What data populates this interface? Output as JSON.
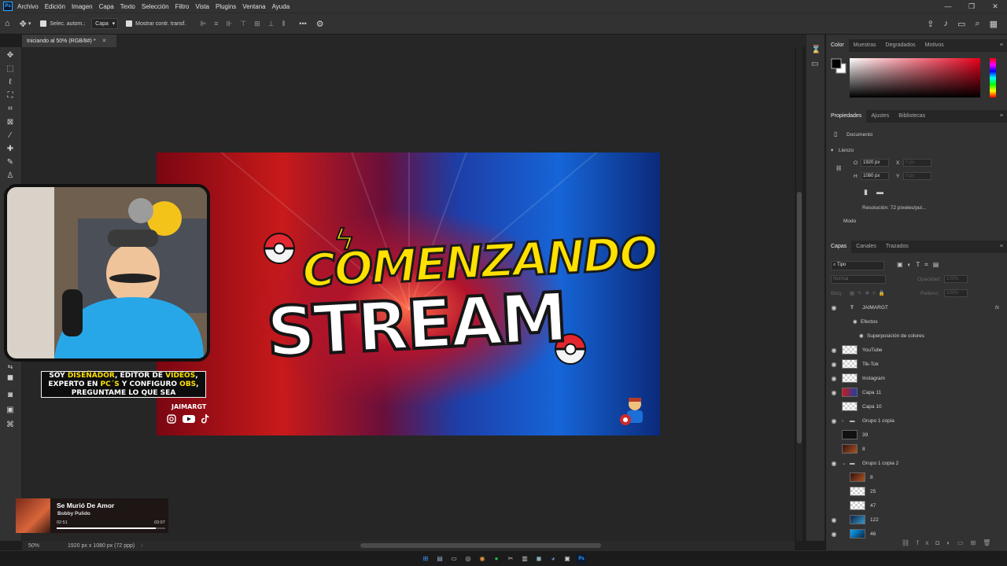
{
  "app": {
    "logo_text": "Ps"
  },
  "menubar": {
    "items": [
      "Archivo",
      "Edición",
      "Imagen",
      "Capa",
      "Texto",
      "Selección",
      "Filtro",
      "Vista",
      "Plugins",
      "Ventana",
      "Ayuda"
    ],
    "window_buttons": [
      "—",
      "❐",
      "✕"
    ]
  },
  "options": {
    "auto_select_label": "Selec. autom.:",
    "auto_select_value": "Capa",
    "show_transform_label": "Mostrar contr. transf.",
    "more_label": "•••"
  },
  "document": {
    "tab_title": "Iniciando al 50% (RGB/8#) *",
    "zoom": "50%",
    "dimensions": "1920 px x 1080 px (72 ppp)"
  },
  "artwork": {
    "title_top": "COMENZANDO",
    "title_main": "STREAM",
    "promo_parts": [
      "SOY ",
      "DISEÑADOR",
      ", EDITOR DE ",
      "VIDEOS",
      ", EXPERTO EN ",
      "PC´S",
      " Y CONFIGURO ",
      "OBS",
      ", PREGUNTAME LO QUE SEA"
    ],
    "handle": "JAIMARGT",
    "accent_color": "#ffe100"
  },
  "music": {
    "song": "Se Murió De Amor",
    "artist": "Bobby Pulido",
    "elapsed": "02:51",
    "duration": "03:07",
    "progress": 0.91
  },
  "panels": {
    "color_tabs": [
      "Color",
      "Muestras",
      "Degradados",
      "Motivos"
    ],
    "props_tabs": [
      "Propiedades",
      "Ajustes",
      "Bibliotecas"
    ],
    "props": {
      "section": "Documento",
      "canvas_heading": "Lienzo",
      "w_label": "O",
      "w_value": "1920 px",
      "h_label": "H",
      "h_value": "1080 px",
      "x_label": "X",
      "x_value": "0 px",
      "y_label": "Y",
      "y_value": "0 px",
      "resolution": "Resolución: 72 píxeles/pul...",
      "mode_label": "Modo"
    },
    "layers_tabs": [
      "Capas",
      "Canales",
      "Trazados"
    ],
    "layers_filter": "Tipo",
    "blend_mode": "Normal",
    "opacity_label": "Opacidad:",
    "opacity_value": "100%",
    "lock_label": "Bloq.:",
    "fill_label": "Relleno:",
    "fill_value": "100%",
    "layers": [
      {
        "name": "JAIMARGT",
        "visible": true,
        "type": "text",
        "fx": true
      },
      {
        "name": "Efectos",
        "visible": true,
        "type": "effects"
      },
      {
        "name": "Superposición de colores",
        "visible": true,
        "type": "effect"
      },
      {
        "name": "YouTube",
        "visible": true,
        "type": "layer"
      },
      {
        "name": "Tik-Tok",
        "visible": true,
        "type": "layer"
      },
      {
        "name": "Instagram",
        "visible": true,
        "type": "layer"
      },
      {
        "name": "Capa 11",
        "visible": true,
        "type": "layer"
      },
      {
        "name": "Capa 10",
        "visible": false,
        "type": "layer"
      },
      {
        "name": "Grupo 1 copia",
        "visible": true,
        "type": "group"
      },
      {
        "name": "39",
        "visible": false,
        "type": "layer"
      },
      {
        "name": "8",
        "visible": false,
        "type": "layer"
      },
      {
        "name": "Grupo 1 copia 2",
        "visible": true,
        "type": "group-open"
      },
      {
        "name": "8",
        "visible": false,
        "type": "layer"
      },
      {
        "name": "25",
        "visible": false,
        "type": "layer"
      },
      {
        "name": "47",
        "visible": false,
        "type": "layer"
      },
      {
        "name": "122",
        "visible": true,
        "type": "layer"
      },
      {
        "name": "46",
        "visible": true,
        "type": "layer"
      }
    ]
  }
}
